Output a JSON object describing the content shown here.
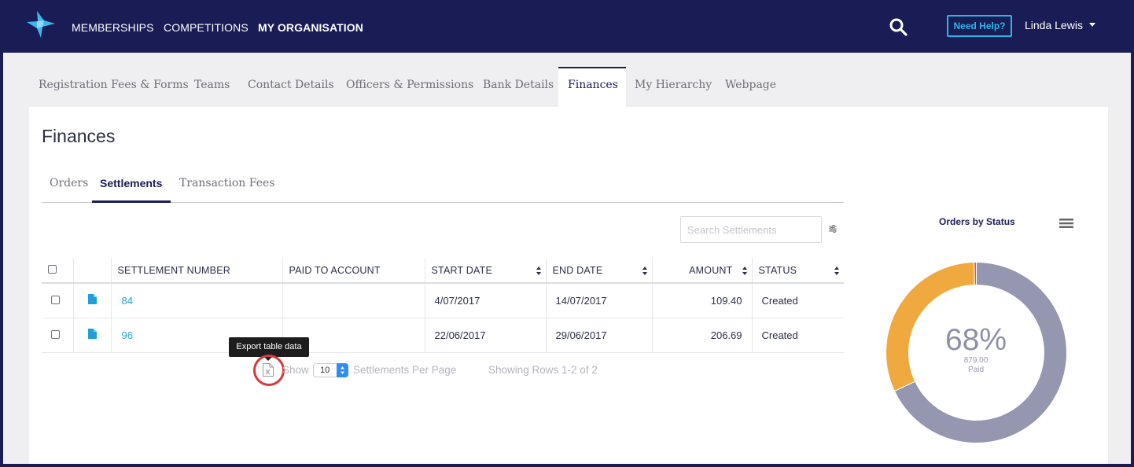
{
  "topnav": {
    "items": [
      {
        "label": "MEMBERSHIPS"
      },
      {
        "label": "COMPETITIONS"
      },
      {
        "label": "MY ORGANISATION"
      }
    ],
    "help_label": "Need Help?",
    "user_name": "Linda Lewis"
  },
  "subtabs": [
    {
      "label": "Registration Fees & Forms"
    },
    {
      "label": "Teams"
    },
    {
      "label": "Contact Details"
    },
    {
      "label": "Officers & Permissions"
    },
    {
      "label": "Bank Details"
    },
    {
      "label": "Finances"
    },
    {
      "label": "My Hierarchy"
    },
    {
      "label": "Webpage"
    }
  ],
  "page": {
    "title": "Finances"
  },
  "inner_tabs": [
    {
      "label": "Orders"
    },
    {
      "label": "Settlements"
    },
    {
      "label": "Transaction Fees"
    }
  ],
  "search": {
    "placeholder": "Search Settlements"
  },
  "table": {
    "headers": [
      "SETTLEMENT NUMBER",
      "PAID TO ACCOUNT",
      "START DATE",
      "END DATE",
      "AMOUNT",
      "STATUS"
    ],
    "rows": [
      {
        "number": "84",
        "account": "",
        "start": "4/07/2017",
        "end": "14/07/2017",
        "amount": "109.40",
        "status": "Created"
      },
      {
        "number": "96",
        "account": "",
        "start": "22/06/2017",
        "end": "29/06/2017",
        "amount": "206.69",
        "status": "Created"
      }
    ]
  },
  "pager": {
    "tooltip": "Export table data",
    "show_label": "Show",
    "per_page_value": "10",
    "per_page_label": "Settlements Per Page",
    "rows_info": "Showing Rows 1-2 of 2"
  },
  "chart_data": {
    "type": "pie",
    "title": "Orders by Status",
    "center_percent": "68%",
    "center_value": "879.00",
    "center_label": "Paid",
    "slices": [
      {
        "value": 68,
        "color": "#9596b0"
      },
      {
        "value": 31.6,
        "color": "#f0a93e"
      },
      {
        "value": 0.4,
        "color": "#e15a4b"
      }
    ]
  },
  "colors": {
    "brand_navy": "#1a1d55",
    "accent_blue": "#29b6e8",
    "link_blue": "#1f9fd8"
  }
}
